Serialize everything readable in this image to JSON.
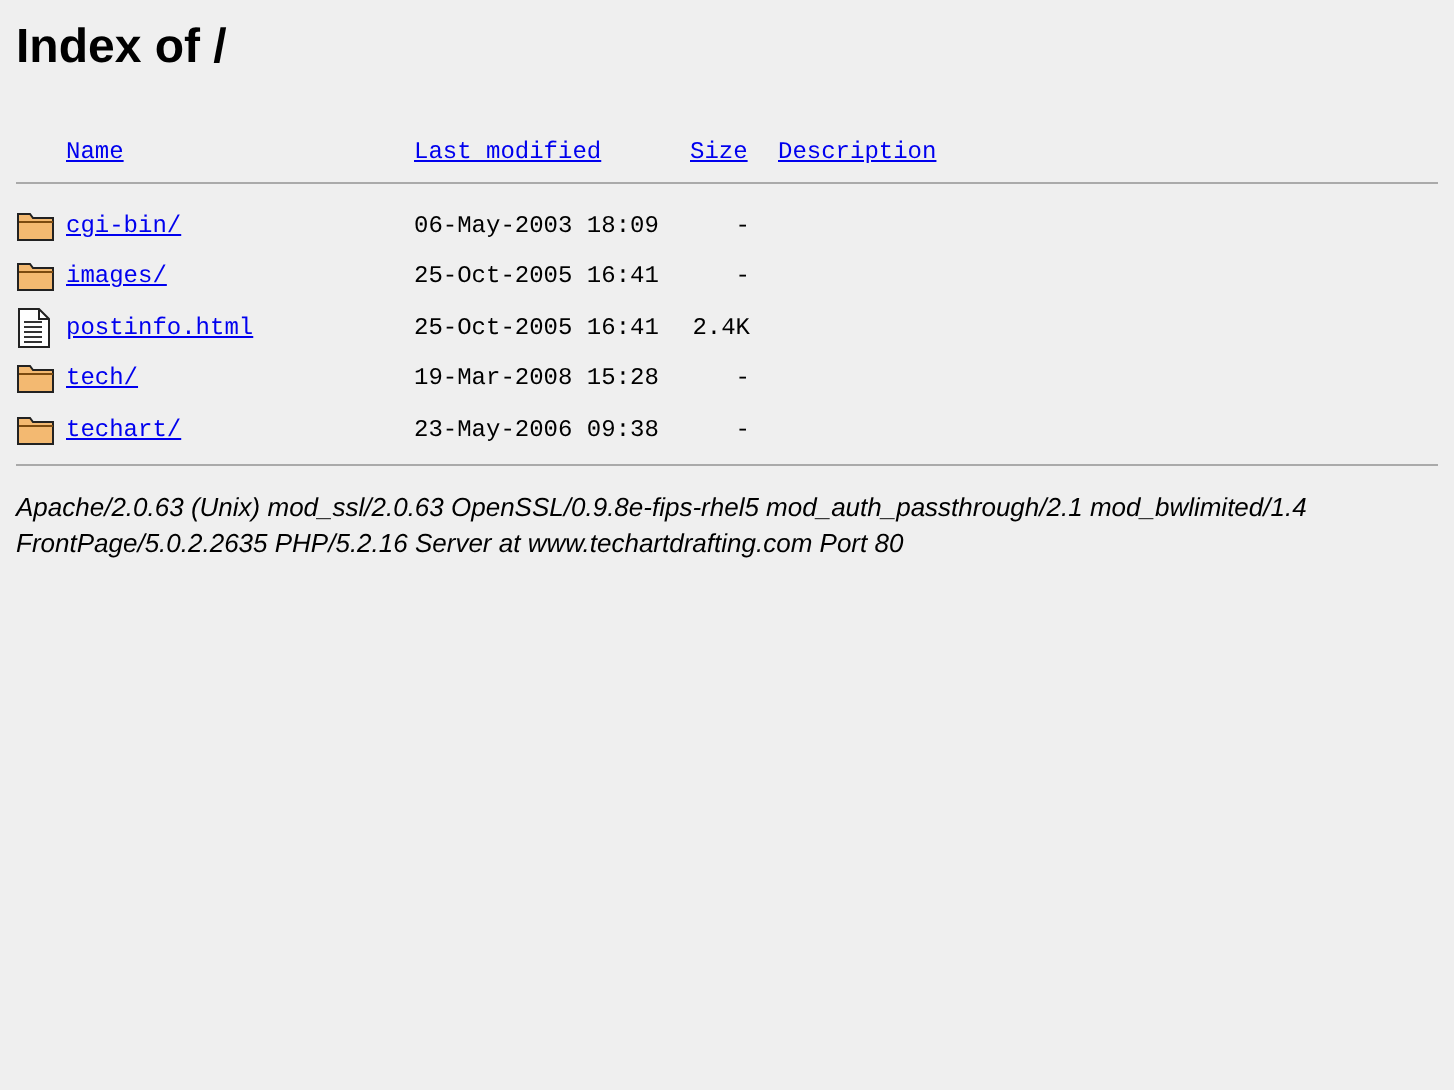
{
  "title": "Index of /",
  "columns": [
    "Name",
    "Last modified",
    "Size",
    "Description"
  ],
  "rows": [
    {
      "kind": "folder",
      "name": "cgi-bin/",
      "modified": "06-May-2003 18:09",
      "size": "-"
    },
    {
      "kind": "folder",
      "name": "images/",
      "modified": "25-Oct-2005 16:41",
      "size": "-"
    },
    {
      "kind": "file",
      "name": "postinfo.html",
      "modified": "25-Oct-2005 16:41",
      "size": "2.4K"
    },
    {
      "kind": "folder",
      "name": "tech/",
      "modified": "19-Mar-2008 15:28",
      "size": "-"
    },
    {
      "kind": "folder",
      "name": "techart/",
      "modified": "23-May-2006 09:38",
      "size": "-"
    }
  ],
  "address": "Apache/2.0.63 (Unix) mod_ssl/2.0.63 OpenSSL/0.9.8e-fips-rhel5 mod_auth_passthrough/2.1 mod_bwlimited/1.4 FrontPage/5.0.2.2635 PHP/5.2.16 Server at www.techartdrafting.com Port 80"
}
